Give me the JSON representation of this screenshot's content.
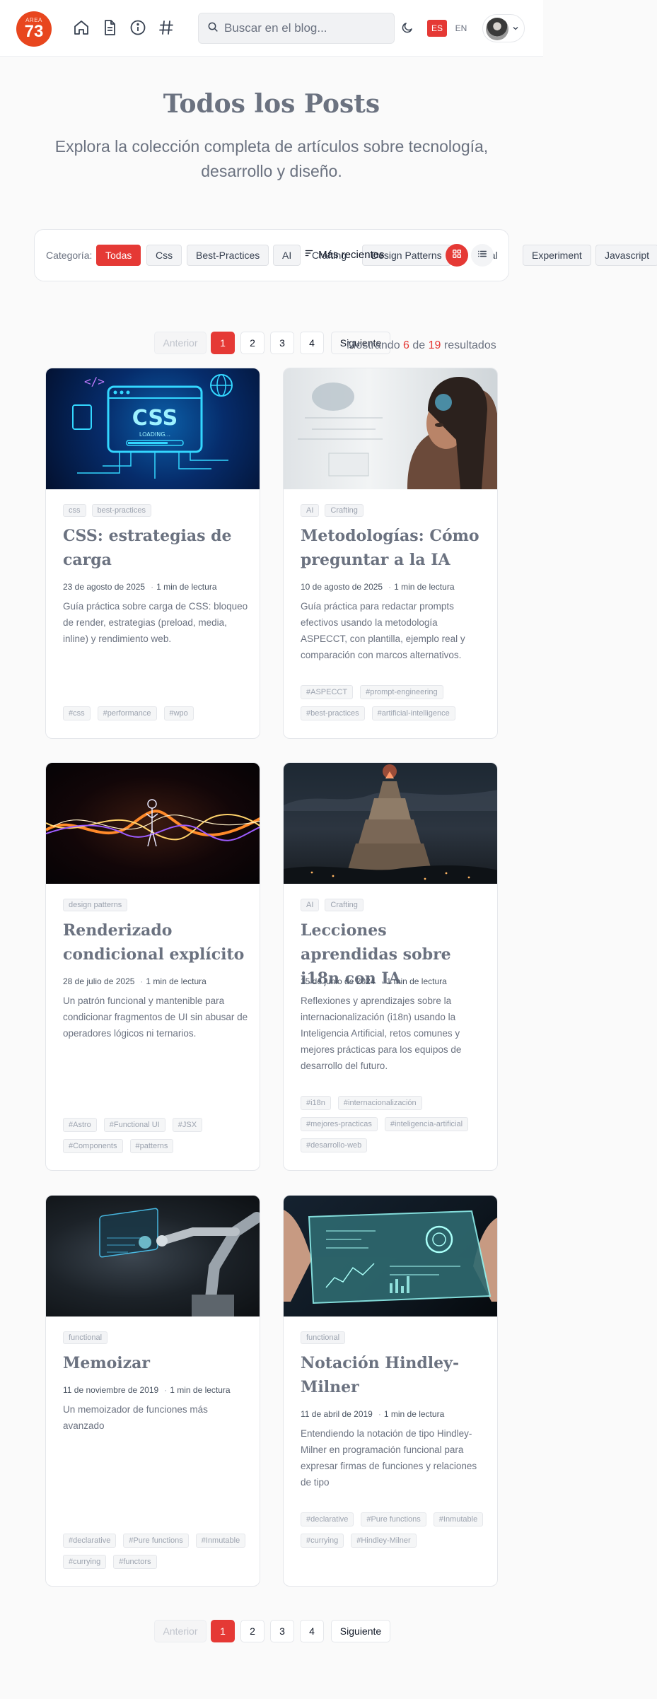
{
  "colors": {
    "accent": "#e53935",
    "logo": "#e8461e"
  },
  "header": {
    "logo_top": "AREA",
    "logo_num": "73",
    "nav_icons": [
      "home-icon",
      "document-icon",
      "info-icon",
      "hash-icon"
    ],
    "search_placeholder": "Buscar en el blog...",
    "theme_icon": "moon-icon",
    "lang_es": "ES",
    "lang_en": "EN"
  },
  "hero": {
    "title": "Todos los Posts",
    "subtitle": "Explora la colección completa de artículos sobre tecnología, desarrollo y diseño."
  },
  "filters": {
    "label": "Categoría:",
    "categories": [
      "Todas",
      "Css",
      "Best-Practices",
      "AI",
      "Crafting",
      "Design Patterns",
      "nal",
      "Experiment",
      "Javascript"
    ],
    "active": "Todas",
    "sort_label": "Más recientes",
    "view_grid_icon": "grid-icon",
    "view_list_icon": "list-icon"
  },
  "pagination": {
    "prev": "Anterior",
    "pages": [
      "1",
      "2",
      "3",
      "4"
    ],
    "next": "Siguiente",
    "current": "1"
  },
  "results": {
    "prefix": "Mostrando",
    "shown": "6",
    "middle": "de",
    "total": "19",
    "suffix": "resultados"
  },
  "posts": [
    {
      "image": "css-loading-illustration",
      "categories": [
        "css",
        "best-practices"
      ],
      "title": "CSS: estrategias de carga",
      "date": "23 de agosto de 2025",
      "read_time": "1 min de lectura",
      "description": "Guía práctica sobre carga de CSS: bloqueo de render, estrategias (preload, media, inline) y rendimiento web.",
      "tags": [
        "#css",
        "#performance",
        "#wpo"
      ]
    },
    {
      "image": "ai-woman-illustration",
      "categories": [
        "AI",
        "Crafting"
      ],
      "title": "Metodologías: Cómo preguntar a la IA",
      "date": "10 de agosto de 2025",
      "read_time": "1 min de lectura",
      "description": "Guía práctica para redactar prompts efectivos usando la metodología ASPECCT, con plantilla, ejemplo real y comparación con marcos alternativos.",
      "tags": [
        "#ASPECCT",
        "#prompt-engineering",
        "#best-practices",
        "#artificial-intelligence"
      ]
    },
    {
      "image": "energy-figure-illustration",
      "categories": [
        "design patterns"
      ],
      "title": "Renderizado condicional explícito",
      "date": "28 de julio de 2025",
      "read_time": "1 min de lectura",
      "description": "Un patrón funcional y mantenible para condicionar fragmentos de UI sin abusar de operadores lógicos ni ternarios.",
      "tags": [
        "#Astro",
        "#Functional UI",
        "#JSX",
        "#Components",
        "#patterns"
      ]
    },
    {
      "image": "babel-tower-illustration",
      "categories": [
        "AI",
        "Crafting"
      ],
      "title": "Lecciones aprendidas sobre i18n con IA",
      "date": "15 de junio de 2024",
      "read_time": "1 min de lectura",
      "description": "Reflexiones y aprendizajes sobre la internacionalización (i18n) usando la Inteligencia Artificial, retos comunes y mejores prácticas para los equipos de desarrollo del futuro.",
      "tags": [
        "#i18n",
        "#internacionalización",
        "#mejores-practicas",
        "#inteligencia-artificial",
        "#desarrollo-web"
      ]
    },
    {
      "image": "robot-arm-illustration",
      "categories": [
        "functional"
      ],
      "title": "Memoizar",
      "date": "11 de noviembre de 2019",
      "read_time": "1 min de lectura",
      "description": "Un memoizador de funciones más avanzado",
      "tags": [
        "#declarative",
        "#Pure functions",
        "#Inmutable",
        "#currying",
        "#functors"
      ]
    },
    {
      "image": "glass-tablet-illustration",
      "categories": [
        "functional"
      ],
      "title": "Notación Hindley-Milner",
      "date": "11 de abril de 2019",
      "read_time": "1 min de lectura",
      "description": "Entendiendo la notación de tipo Hindley-Milner en programación funcional para expresar firmas de funciones y relaciones de tipo",
      "tags": [
        "#declarative",
        "#Pure functions",
        "#Inmutable",
        "#currying",
        "#Hindley-Milner"
      ]
    }
  ]
}
